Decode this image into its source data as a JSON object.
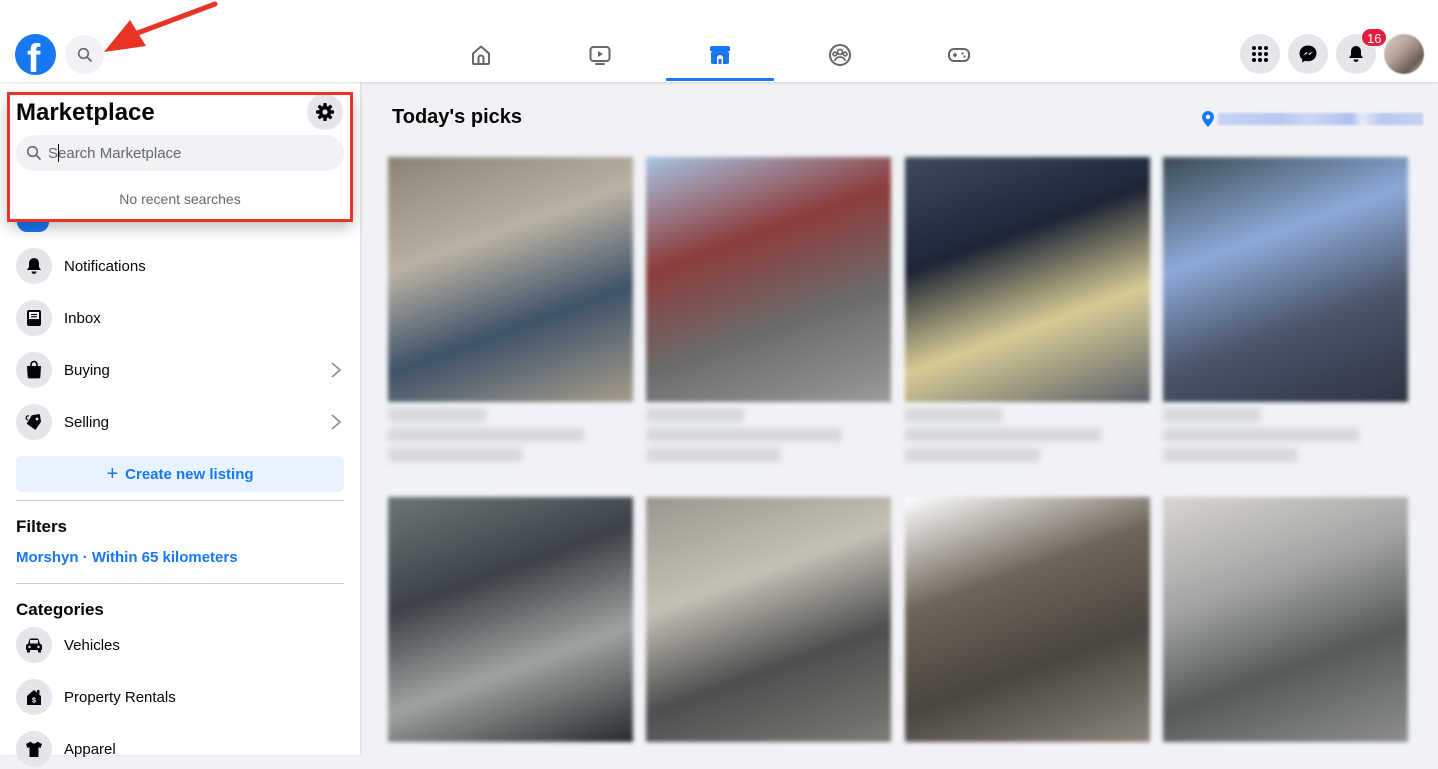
{
  "topbar": {
    "logo_glyph": "f",
    "search_button": "search-icon",
    "nav_tabs": [
      {
        "name": "home",
        "icon": "home-icon",
        "active": false
      },
      {
        "name": "watch",
        "icon": "video-icon",
        "active": false
      },
      {
        "name": "marketplace",
        "icon": "marketplace-icon",
        "active": true
      },
      {
        "name": "groups",
        "icon": "groups-icon",
        "active": false
      },
      {
        "name": "gaming",
        "icon": "gaming-icon",
        "active": false
      }
    ],
    "right_buttons": [
      "menu-grid-icon",
      "messenger-icon",
      "notifications-bell-icon"
    ],
    "notification_count": "16",
    "accent_color": "#1877f2",
    "badge_color": "#e41e3f"
  },
  "marketplace_popup": {
    "title": "Marketplace",
    "search_placeholder": "Search Marketplace",
    "search_value": "",
    "empty_text": "No recent searches"
  },
  "sidebar": {
    "items": [
      {
        "label": "Notifications",
        "icon": "bell-icon",
        "has_chevron": false
      },
      {
        "label": "Inbox",
        "icon": "inbox-icon",
        "has_chevron": false
      },
      {
        "label": "Buying",
        "icon": "shopping-bag-icon",
        "has_chevron": true
      },
      {
        "label": "Selling",
        "icon": "price-tag-icon",
        "has_chevron": true
      }
    ],
    "create_listing_label": "Create new listing",
    "create_listing_plus": "+",
    "filters_title": "Filters",
    "filter_location": "Morshyn · Within 65 kilometers",
    "categories_title": "Categories",
    "categories": [
      {
        "label": "Vehicles",
        "icon": "car-icon"
      },
      {
        "label": "Property Rentals",
        "icon": "house-dollar-icon"
      },
      {
        "label": "Apparel",
        "icon": "tshirt-icon"
      }
    ]
  },
  "main": {
    "section_title": "Today's picks",
    "location_icon": "location-pin-icon",
    "listings": [
      {
        "image_palette": [
          "#8a8476",
          "#b9b2a3",
          "#3f5268",
          "#a59d8c"
        ]
      },
      {
        "image_palette": [
          "#a7c3e0",
          "#8c3b3b",
          "#6b6b6b",
          "#9a9a98"
        ]
      },
      {
        "image_palette": [
          "#3e4a5e",
          "#1d2535",
          "#d7cc95",
          "#5a5f6a"
        ]
      },
      {
        "image_palette": [
          "#3b4a52",
          "#8ea9d8",
          "#4b566a",
          "#2e3440"
        ]
      },
      {
        "image_palette": [
          "#6e7679",
          "#3c4247",
          "#9ea3a0",
          "#252a2e"
        ]
      },
      {
        "image_palette": [
          "#9a978e",
          "#c5c0b6",
          "#4d4e4e",
          "#7d7b75"
        ]
      },
      {
        "image_palette": [
          "#ffffff",
          "#6d6559",
          "#4a4540",
          "#8a857c"
        ]
      },
      {
        "image_palette": [
          "#d9d4d1",
          "#a4a6a4",
          "#555a58",
          "#8d8f8d"
        ]
      }
    ]
  },
  "annotations": {
    "arrow_color": "#e93324",
    "box_color": "#e93324"
  }
}
